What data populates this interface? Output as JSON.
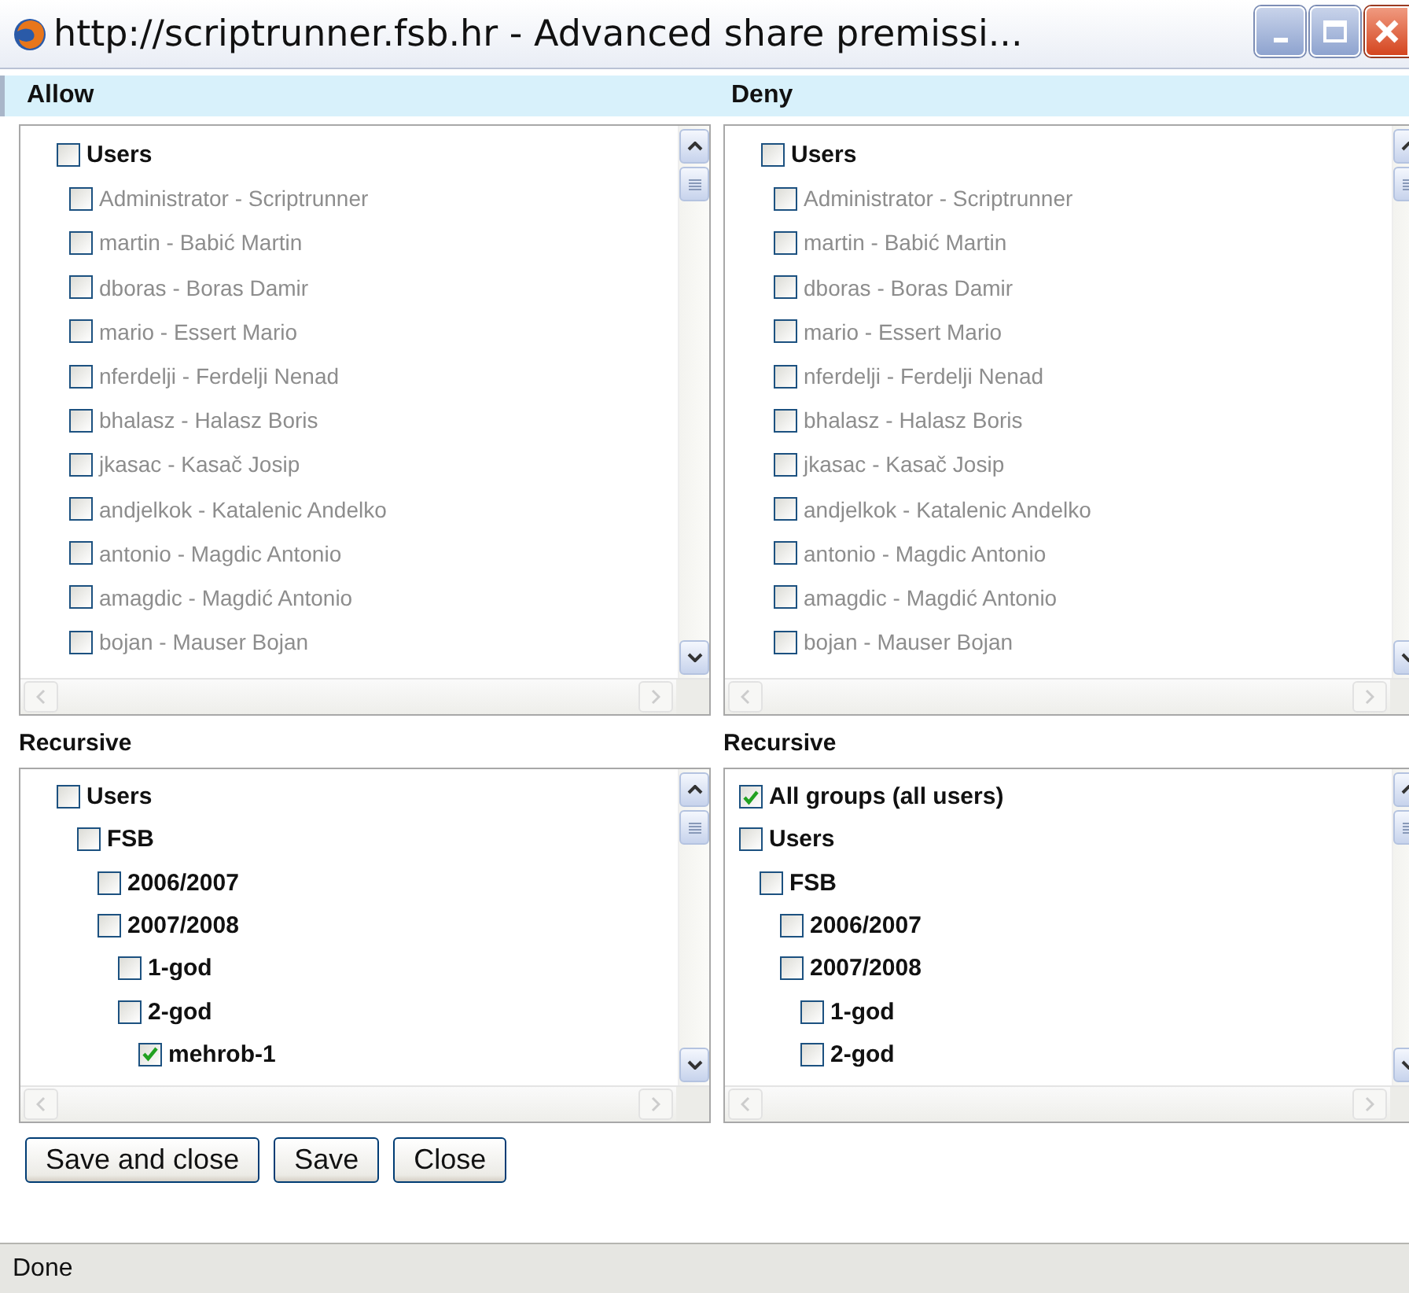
{
  "window": {
    "title": "http://scriptrunner.fsb.hr - Advanced share premissi..."
  },
  "panels": [
    {
      "header": "Allow",
      "tree": [
        {
          "label": "Users",
          "checked": false,
          "disabled": false,
          "children": [
            {
              "label": "Administrator - Scriptrunner",
              "checked": false,
              "disabled": true
            },
            {
              "label": "martin - Babić Martin",
              "checked": false,
              "disabled": true
            },
            {
              "label": "dboras - Boras Damir",
              "checked": false,
              "disabled": true
            },
            {
              "label": "mario - Essert Mario",
              "checked": false,
              "disabled": true
            },
            {
              "label": "nferdelji - Ferdelji Nenad",
              "checked": false,
              "disabled": true
            },
            {
              "label": "bhalasz - Halasz Boris",
              "checked": false,
              "disabled": true
            },
            {
              "label": "jkasac - Kasač Josip",
              "checked": false,
              "disabled": true
            },
            {
              "label": "andjelkok - Katalenic Andelko",
              "checked": false,
              "disabled": true
            },
            {
              "label": "antonio - Magdic Antonio",
              "checked": false,
              "disabled": true
            },
            {
              "label": "amagdic - Magdić Antonio",
              "checked": false,
              "disabled": true
            },
            {
              "label": "bojan - Mauser Bojan",
              "checked": false,
              "disabled": true
            }
          ]
        }
      ],
      "recursive_label": "Recursive",
      "recursive_tree": [
        {
          "label": "Users",
          "checked": false,
          "disabled": false,
          "children": [
            {
              "label": "FSB",
              "checked": false,
              "disabled": false,
              "children": [
                {
                  "label": "2006/2007",
                  "checked": false,
                  "disabled": false
                },
                {
                  "label": "2007/2008",
                  "checked": false,
                  "disabled": false,
                  "children": [
                    {
                      "label": "1-god",
                      "checked": false,
                      "disabled": false
                    },
                    {
                      "label": "2-god",
                      "checked": false,
                      "disabled": false,
                      "children": [
                        {
                          "label": "mehrob-1",
                          "checked": true,
                          "disabled": false
                        }
                      ]
                    }
                  ]
                }
              ]
            }
          ]
        }
      ]
    },
    {
      "header": "Deny",
      "tree": [
        {
          "label": "Users",
          "checked": false,
          "disabled": false,
          "children": [
            {
              "label": "Administrator - Scriptrunner",
              "checked": false,
              "disabled": true
            },
            {
              "label": "martin - Babić Martin",
              "checked": false,
              "disabled": true
            },
            {
              "label": "dboras - Boras Damir",
              "checked": false,
              "disabled": true
            },
            {
              "label": "mario - Essert Mario",
              "checked": false,
              "disabled": true
            },
            {
              "label": "nferdelji - Ferdelji Nenad",
              "checked": false,
              "disabled": true
            },
            {
              "label": "bhalasz - Halasz Boris",
              "checked": false,
              "disabled": true
            },
            {
              "label": "jkasac - Kasač Josip",
              "checked": false,
              "disabled": true
            },
            {
              "label": "andjelkok - Katalenic Andelko",
              "checked": false,
              "disabled": true
            },
            {
              "label": "antonio - Magdic Antonio",
              "checked": false,
              "disabled": true
            },
            {
              "label": "amagdic - Magdić Antonio",
              "checked": false,
              "disabled": true
            },
            {
              "label": "bojan - Mauser Bojan",
              "checked": false,
              "disabled": true
            }
          ]
        }
      ],
      "recursive_label": "Recursive",
      "recursive_tree": [
        {
          "label": "All groups (all users)",
          "checked": true,
          "disabled": false
        },
        {
          "label": "Users",
          "checked": false,
          "disabled": false,
          "children": [
            {
              "label": "FSB",
              "checked": false,
              "disabled": false,
              "children": [
                {
                  "label": "2006/2007",
                  "checked": false,
                  "disabled": false
                },
                {
                  "label": "2007/2008",
                  "checked": false,
                  "disabled": false,
                  "children": [
                    {
                      "label": "1-god",
                      "checked": false,
                      "disabled": false
                    },
                    {
                      "label": "2-god",
                      "checked": false,
                      "disabled": false
                    }
                  ]
                }
              ]
            }
          ]
        }
      ]
    }
  ],
  "buttons": [
    "Save and close",
    "Save",
    "Close"
  ],
  "status_bar": "Done"
}
